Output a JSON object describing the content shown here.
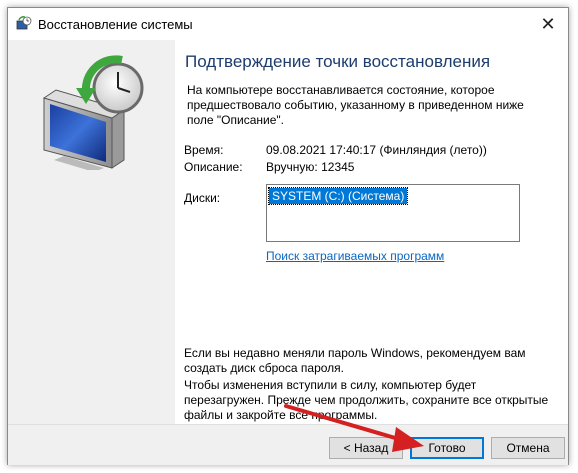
{
  "window": {
    "title": "Восстановление системы",
    "close_glyph": "✕"
  },
  "content": {
    "heading": "Подтверждение точки восстановления",
    "intro": "На компьютере восстанавливается состояние, которое предшествовало событию, указанному в приведенном ниже поле \"Описание\".",
    "fields": [
      {
        "label": "Время:",
        "value": "09.08.2021 17:40:17 (Финляндия (лето))"
      },
      {
        "label": "Описание:",
        "value": "Вручную: 12345"
      }
    ],
    "disks_label": "Диски:",
    "disks": [
      "SYSTEM (C:) (Система)"
    ],
    "scan_link": "Поиск затрагиваемых программ",
    "note_password": "Если вы недавно меняли пароль Windows, рекомендуем вам создать диск сброса пароля.",
    "note_restart": "Чтобы изменения вступили в силу, компьютер будет перезагружен. Прежде чем продолжить, сохраните все открытые файлы и закройте все программы."
  },
  "buttons": {
    "back": "< Назад",
    "finish": "Готово",
    "cancel": "Отмена"
  },
  "icons": {
    "app": "system-restore-icon",
    "hero": "system-restore-monitor-clock-icon",
    "annotation": "red-arrow-annotation"
  },
  "colors": {
    "heading": "#1d3c6e",
    "selection": "#0078d7",
    "link": "#0a66c2",
    "annotation_arrow": "#d42020"
  }
}
